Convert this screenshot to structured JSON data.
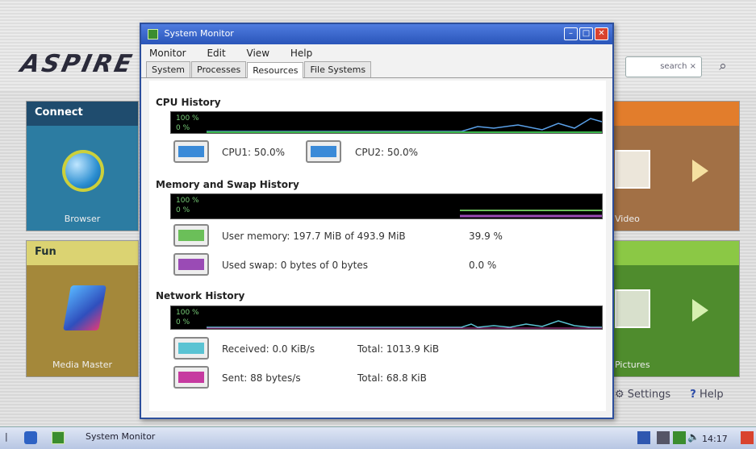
{
  "window": {
    "title": "System Monitor",
    "menu": [
      "Monitor",
      "Edit",
      "View",
      "Help"
    ],
    "tabs": [
      "System",
      "Processes",
      "Resources",
      "File Systems"
    ],
    "active_tab": "Resources"
  },
  "cpu": {
    "title": "CPU History",
    "scale_top": "100 %",
    "scale_bottom": "0 %",
    "cpu1": "CPU1: 50.0%",
    "cpu2": "CPU2: 50.0%",
    "colors": {
      "cpu1": "#3a8ad8",
      "cpu2": "#3a8ad8",
      "line": "#39b54a"
    }
  },
  "memory": {
    "title": "Memory and Swap History",
    "scale_top": "100 %",
    "scale_bottom": "0 %",
    "user_memory": "User memory: 197.7 MiB of 493.9 MiB",
    "user_memory_percent": "39.9 %",
    "used_swap": "Used swap: 0 bytes of 0 bytes",
    "used_swap_percent": "0.0 %",
    "colors": {
      "memory": "#6bbf59",
      "swap": "#9a4bb5"
    }
  },
  "network": {
    "title": "Network History",
    "scale_top": "100 %",
    "scale_bottom": "0 %",
    "received": "Received: 0.0 KiB/s",
    "received_total": "Total: 1013.9 KiB",
    "sent": "Sent: 88 bytes/s",
    "sent_total": "Total: 68.8 KiB",
    "colors": {
      "received": "#5ac3d3",
      "sent": "#c63aa0"
    }
  },
  "launcher": {
    "logo": "ASPIRE",
    "search_button": "search",
    "tile_connect_head": "Connect",
    "tile_connect_label": "Browser",
    "tile_fun_head": "Fun",
    "tile_fun_label": "Media Master",
    "tile_right_top_label": "Video",
    "tile_right_bot_label": "Pictures",
    "settings": "Settings",
    "help": "Help"
  },
  "taskbar": {
    "task_label": "System Monitor",
    "clock": "14:17"
  }
}
